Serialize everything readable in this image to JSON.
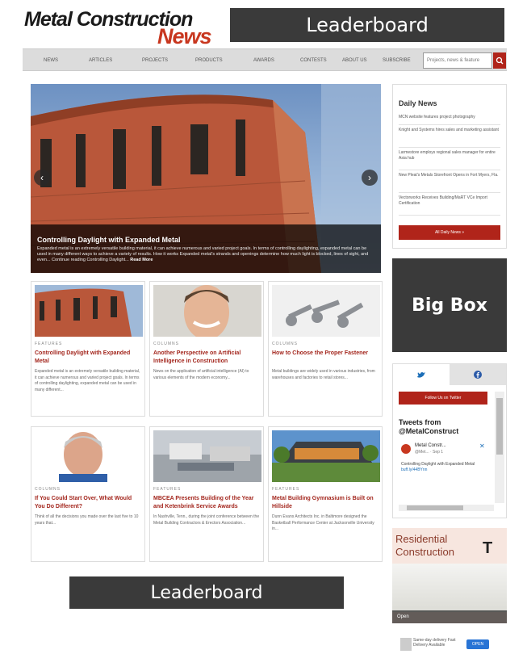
{
  "logo": {
    "line1": "Metal Construction",
    "line2": "News"
  },
  "ads": {
    "leaderboard_top": "Leaderboard",
    "leaderboard_bottom": "Leaderboard",
    "big_box": "Big Box",
    "residential_line1": "Residential",
    "residential_line2": "Construction",
    "residential_open": "Open"
  },
  "nav": {
    "items": [
      "NEWS",
      "ARTICLES",
      "PROJECTS",
      "PRODUCTS",
      "AWARDS",
      "CONTESTS",
      "ABOUT US",
      "SUBSCRIBE"
    ],
    "search_placeholder": "Projects, news & feature"
  },
  "hero": {
    "title": "Controlling Daylight with Expanded Metal",
    "text": "Expanded metal is an extremely versatile building material, it can achieve numerous and varied project goals. In terms of controlling daylighting, expanded metal can be used in many different ways to achieve a variety of results. How it works Expanded metal's strands and openings determine how much light is blocked, lines of sight, and even... Continue reading Controlling Daylight...",
    "more": "Read More"
  },
  "cards": [
    {
      "category": "FEATURES",
      "title": "Controlling Daylight with Expanded Metal",
      "text": "Expanded metal is an extremely versatile building material, it can achieve numerous and varied project goals. In terms of controlling daylighting, expanded metal can be used in many different..."
    },
    {
      "category": "COLUMNS",
      "title": "Another Perspective on Artificial Intelligence in Construction",
      "text": "News on the application of artificial intelligence (AI) to various elements of the modern economy..."
    },
    {
      "category": "COLUMNS",
      "title": "How to Choose the Proper Fastener",
      "text": "Metal buildings are widely used in various industries, from warehouses and factories to retail stores..."
    },
    {
      "category": "COLUMNS",
      "title": "If You Could Start Over, What Would You Do Different?",
      "text": "Think of all the decisions you made over the last five to 10 years that..."
    },
    {
      "category": "FEATURES",
      "title": "MBCEA Presents Building of the Year and Ketenbrink Service Awards",
      "text": "In Nashville, Tenn., during the joint conference between the Metal Building Contractors & Erectors Association..."
    },
    {
      "category": "FEATURES",
      "title": "Metal Building Gymnasium is Built on Hillside",
      "text": "Dunn Evans Architects Inc. in Baltimore designed the Basketball Performance Center at Jacksonville University in..."
    }
  ],
  "daily": {
    "heading": "Daily News",
    "items": [
      "MCN website features project photography",
      "Knight and Systems hires sales and marketing assistant",
      "Larmestore employs regional sales manager for entire Asia hub",
      "New Pleat's Metals Storefront Opens in Fort Myers, Fla.",
      "Vectorworks Receives Building/MaRT VCe Import Certification"
    ],
    "button": "All Daily News »"
  },
  "social": {
    "twitter_icon": "bird-icon",
    "facebook_icon": "facebook-icon",
    "follow_button": "Follow Us on Twitter",
    "tweets_heading_1": "Tweets from",
    "tweets_heading_2": "@MetalConstruct",
    "tweet_name": "Metal Constr...",
    "tweet_handle": "@Met... · Sep 1",
    "tweet_text": "Controlling Daylight with Expanded Metal",
    "tweet_link": "buff.ly/44BYnn"
  },
  "small_ad": {
    "text": "Same-day delivery Fast Delivery Available",
    "button": "OPEN"
  },
  "colors": {
    "brand_red": "#b0241a",
    "logo_red": "#c8371f",
    "ad_gray": "#3a3a3a"
  }
}
